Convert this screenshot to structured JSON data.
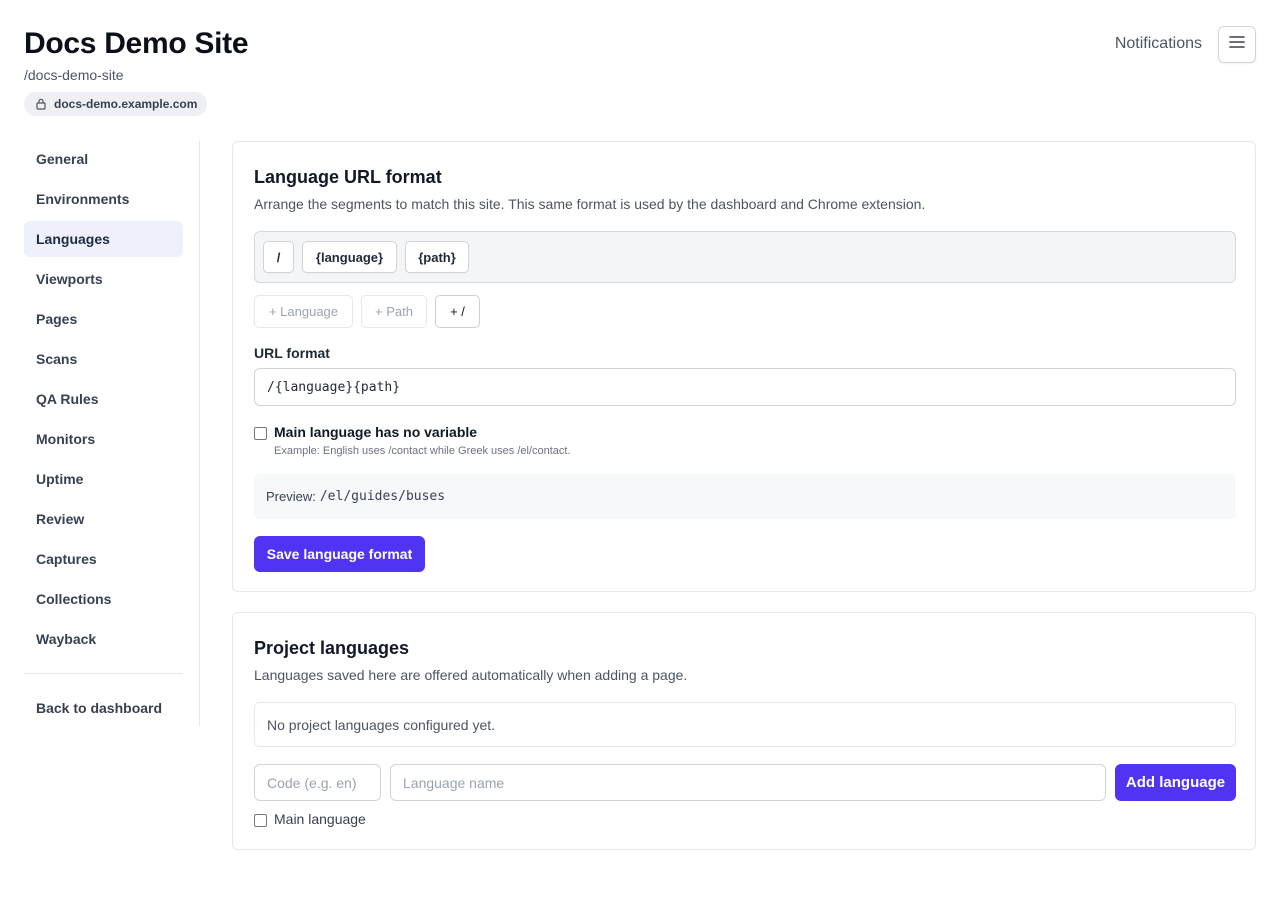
{
  "header": {
    "site_title": "Docs Demo Site",
    "slug": "/docs-demo-site",
    "domain": "docs-demo.example.com",
    "domain_icon": "lock-icon",
    "notifications_label": "Notifications",
    "menu_icon": "hamburger-menu-icon"
  },
  "sidebar": {
    "items": [
      {
        "label": "General",
        "active": false
      },
      {
        "label": "Environments",
        "active": false
      },
      {
        "label": "Languages",
        "active": true
      },
      {
        "label": "Viewports",
        "active": false
      },
      {
        "label": "Pages",
        "active": false
      },
      {
        "label": "Scans",
        "active": false
      },
      {
        "label": "QA Rules",
        "active": false
      },
      {
        "label": "Monitors",
        "active": false
      },
      {
        "label": "Uptime",
        "active": false
      },
      {
        "label": "Review",
        "active": false
      },
      {
        "label": "Captures",
        "active": false
      },
      {
        "label": "Collections",
        "active": false
      },
      {
        "label": "Wayback",
        "active": false
      }
    ],
    "back_label": "Back to dashboard"
  },
  "url_format_card": {
    "title": "Language URL format",
    "description": "Arrange the segments to match this site. This same format is used by the dashboard and Chrome extension.",
    "segments": [
      "/",
      "{language}",
      "{path}"
    ],
    "add_buttons": [
      {
        "label": "+ Language",
        "enabled": false
      },
      {
        "label": "+ Path",
        "enabled": false
      },
      {
        "label": "+ /",
        "enabled": true
      }
    ],
    "field_label": "URL format",
    "field_value": "/{language}{path}",
    "checkbox_label": "Main language has no variable",
    "checkbox_checked": false,
    "checkbox_hint": "Example: English uses /contact while Greek uses /el/contact.",
    "preview_label": "Preview:",
    "preview_value": "/el/guides/buses",
    "save_label": "Save language format"
  },
  "languages_card": {
    "title": "Project languages",
    "description": "Languages saved here are offered automatically when adding a page.",
    "empty_text": "No project languages configured yet.",
    "code_placeholder": "Code (e.g. en)",
    "name_placeholder": "Language name",
    "add_label": "Add language",
    "main_checkbox_label": "Main language",
    "main_checked": false
  },
  "colors": {
    "accent": "#4f35f3",
    "active_nav_bg": "#eef1fb"
  }
}
